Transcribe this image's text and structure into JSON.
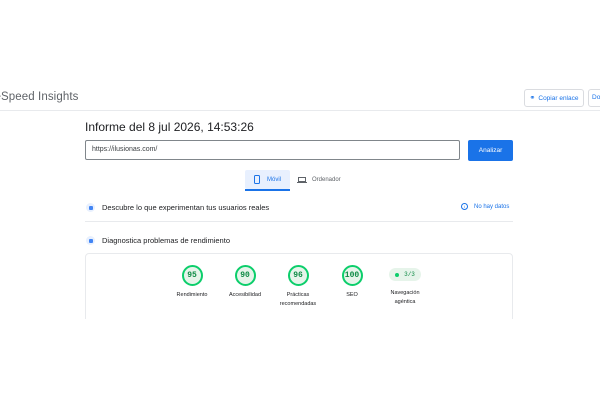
{
  "header": {
    "brand": "geSpeed Insights",
    "copy_link": "Copiar enlace",
    "docs": "Docs"
  },
  "report": {
    "title": "Informe del 8 jul 2026, 14:53:26",
    "url": "https://ilusionas.com/",
    "analyze": "Analizar"
  },
  "tabs": {
    "mobile": "Móvil",
    "desktop": "Ordenador"
  },
  "sections": {
    "field": "Descubre lo que experimentan tus usuarios reales",
    "no_data": "No hay datos",
    "diagnose": "Diagnostica problemas de rendimiento"
  },
  "scores": [
    {
      "value": "95",
      "label": "Rendimiento"
    },
    {
      "value": "90",
      "label": "Accesibilidad"
    },
    {
      "value": "96",
      "label": "Prácticas recomendadas"
    },
    {
      "value": "100",
      "label": "SEO"
    }
  ],
  "agentic": {
    "value": "3/3",
    "label": "Navegación agéntica"
  },
  "colors": {
    "accent": "#1a73e8",
    "pass": "#0cce6b"
  }
}
